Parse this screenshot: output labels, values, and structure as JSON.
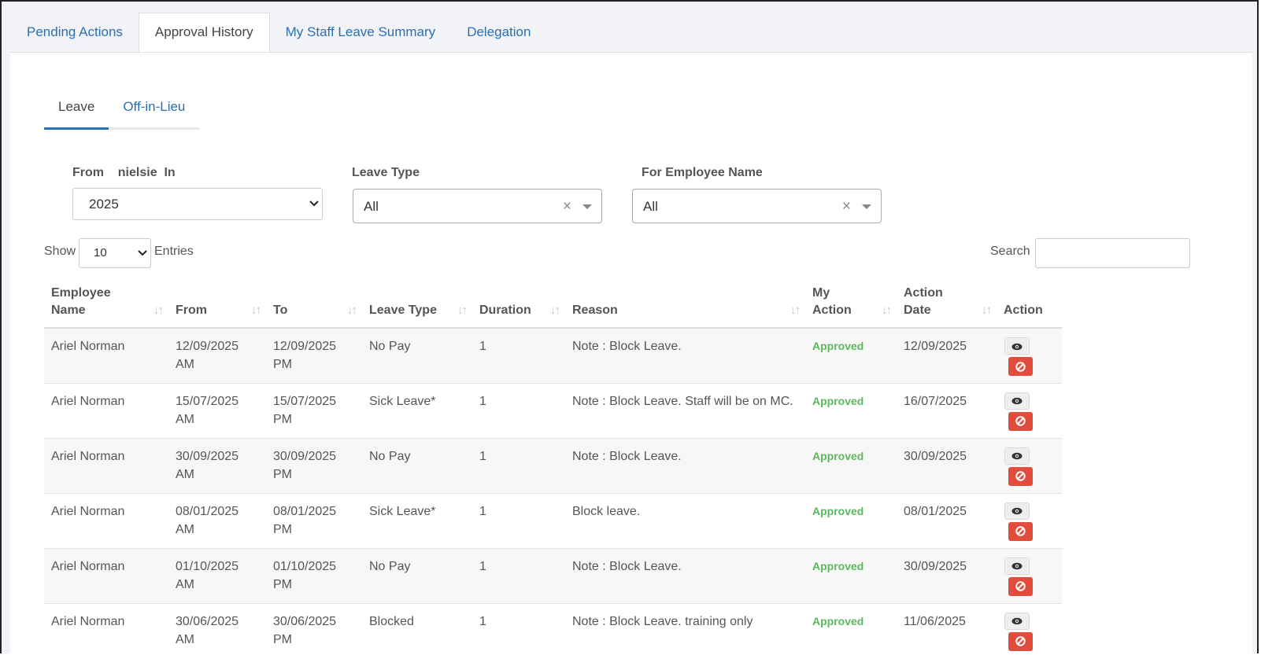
{
  "top_tabs": [
    "Pending Actions",
    "Approval History",
    "My Staff Leave Summary",
    "Delegation"
  ],
  "sub_tabs": [
    "Leave",
    "Off-in-Lieu"
  ],
  "filters": {
    "year_label": "From    nielsie  In",
    "year_value": "2025",
    "leave_type_label": "Leave Type",
    "leave_type_value": "All",
    "employee_label": "For Employee Name",
    "employee_value": "All",
    "clear_glyph": "×"
  },
  "length": {
    "show": "Show",
    "value": "10",
    "entries": "Entries"
  },
  "search": {
    "label": "Search",
    "placeholder": ""
  },
  "columns": [
    "Employee Name",
    "From",
    "To",
    "Leave Type",
    "Duration",
    "Reason",
    "My Action",
    "Action Date",
    "Action"
  ],
  "rows": [
    {
      "name": "Ariel Norman",
      "from": "12/09/2025 AM",
      "to": "12/09/2025 PM",
      "type": "No Pay",
      "duration": "1",
      "reason": "Note : Block Leave.",
      "my_action": "Approved",
      "action_date": "12/09/2025"
    },
    {
      "name": "Ariel Norman",
      "from": "15/07/2025 AM",
      "to": "15/07/2025 PM",
      "type": "Sick Leave*",
      "duration": "1",
      "reason": "Note : Block Leave. Staff will be on MC.",
      "my_action": "Approved",
      "action_date": "16/07/2025"
    },
    {
      "name": "Ariel Norman",
      "from": "30/09/2025 AM",
      "to": "30/09/2025 PM",
      "type": "No Pay",
      "duration": "1",
      "reason": "Note : Block Leave.",
      "my_action": "Approved",
      "action_date": "30/09/2025"
    },
    {
      "name": "Ariel Norman",
      "from": "08/01/2025 AM",
      "to": "08/01/2025 PM",
      "type": "Sick Leave*",
      "duration": "1",
      "reason": "Block leave.",
      "my_action": "Approved",
      "action_date": "08/01/2025"
    },
    {
      "name": "Ariel Norman",
      "from": "01/10/2025 AM",
      "to": "01/10/2025 PM",
      "type": "No Pay",
      "duration": "1",
      "reason": "Note : Block Leave.",
      "my_action": "Approved",
      "action_date": "30/09/2025"
    },
    {
      "name": "Ariel Norman",
      "from": "30/06/2025 AM",
      "to": "30/06/2025 PM",
      "type": "Blocked",
      "duration": "1",
      "reason": "Note : Block Leave. training only",
      "my_action": "Approved",
      "action_date": "11/06/2025"
    }
  ],
  "colors": {
    "link": "#2c6fb3",
    "approved": "#5cb85c",
    "danger": "#e24c3c"
  },
  "icons": {
    "view": "eye-icon",
    "block": "ban-icon",
    "sort": "sort-arrows-icon"
  }
}
